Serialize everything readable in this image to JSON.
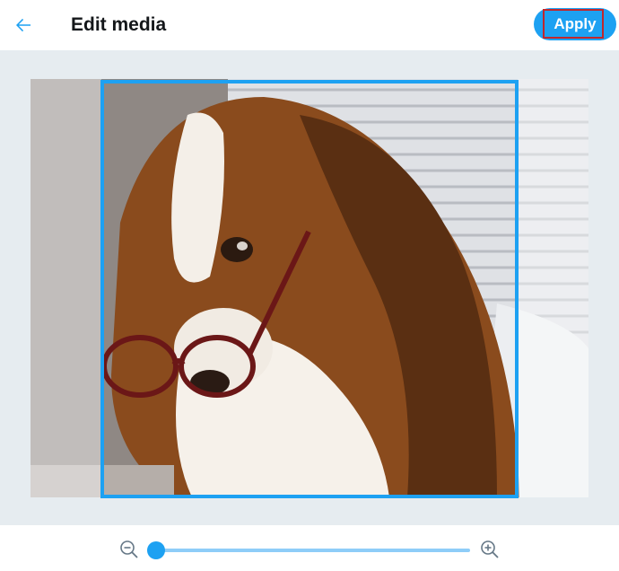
{
  "header": {
    "title": "Edit media",
    "apply_label": "Apply",
    "back_icon": "arrow-left-icon"
  },
  "editor": {
    "image_description_icon": "dog-photo",
    "crop_aspect": "1:1"
  },
  "zoom": {
    "zoom_out_icon": "zoom-out-icon",
    "zoom_in_icon": "zoom-in-icon",
    "level": 0
  },
  "colors": {
    "accent": "#1da1f2",
    "slider_track": "#8ecdf8",
    "editor_bg": "#e6ecf0",
    "highlight": "#c1272d"
  }
}
